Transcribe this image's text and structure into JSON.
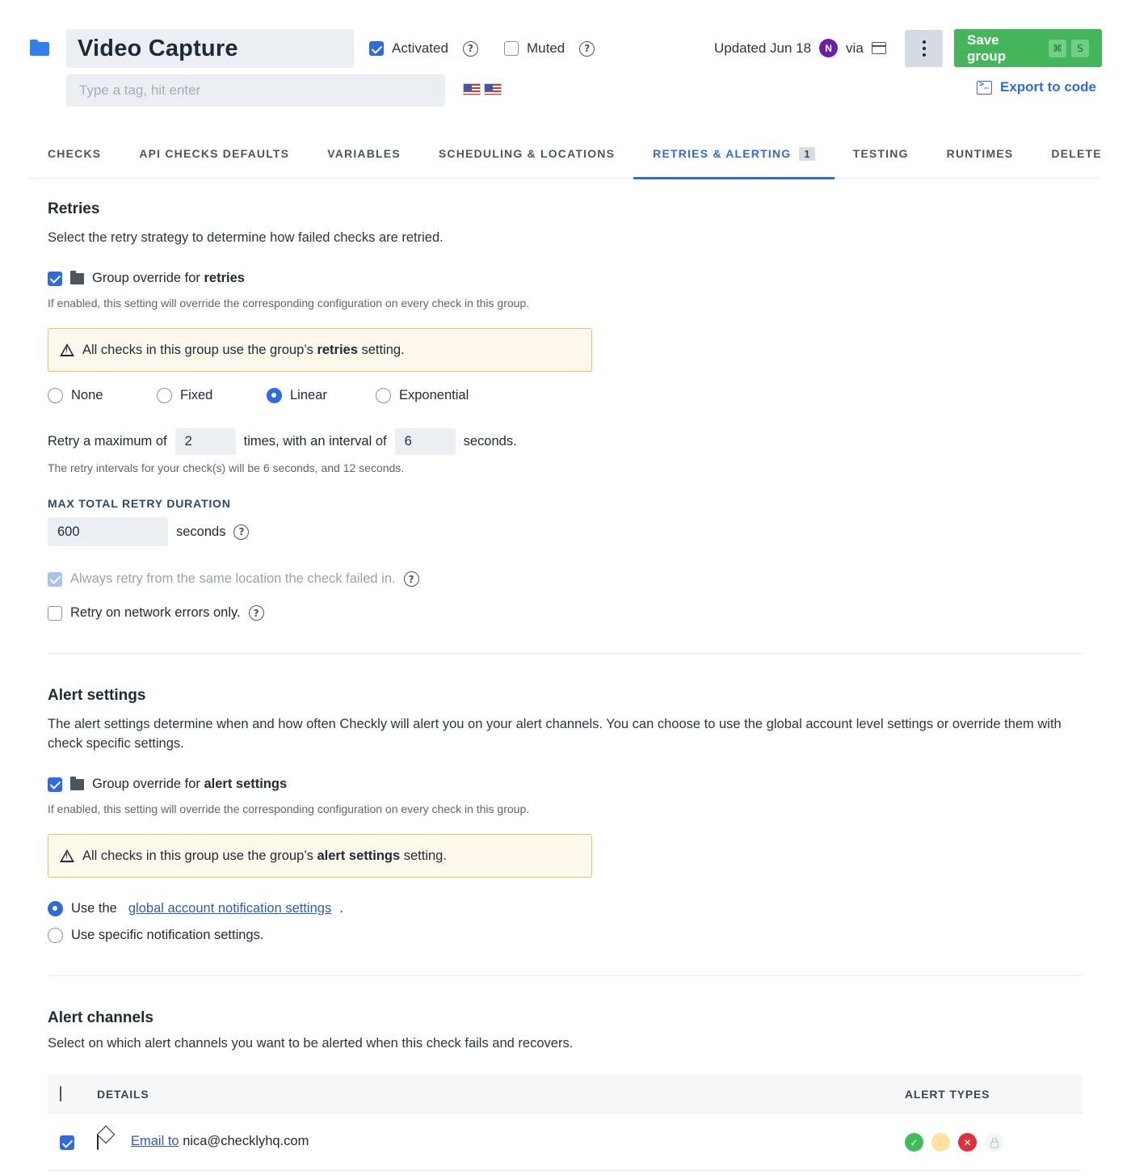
{
  "header": {
    "title": "Video Capture",
    "tag_placeholder": "Type a tag, hit enter",
    "activated_label": "Activated",
    "muted_label": "Muted",
    "updated_label": "Updated Jun 18",
    "avatar_initial": "N",
    "via_label": "via",
    "save_label": "Save group",
    "save_shortcut_keys": [
      "⌘",
      "S"
    ],
    "export_label": "Export to code"
  },
  "tabs": [
    {
      "label": "CHECKS"
    },
    {
      "label": "API CHECKS DEFAULTS"
    },
    {
      "label": "VARIABLES"
    },
    {
      "label": "SCHEDULING & LOCATIONS"
    },
    {
      "label": "RETRIES & ALERTING",
      "count": "1",
      "active": true
    },
    {
      "label": "TESTING"
    },
    {
      "label": "RUNTIMES"
    },
    {
      "label": "DELETE"
    }
  ],
  "retries": {
    "title": "Retries",
    "description": "Select the retry strategy to determine how failed checks are retried.",
    "override_prefix": "Group override for ",
    "override_bold": "retries",
    "override_hint": "If enabled, this setting will override the corresponding configuration on every check in this group.",
    "warning_prefix": "All checks in this group use the group’s ",
    "warning_bold": "retries",
    "warning_suffix": " setting.",
    "strategies": [
      "None",
      "Fixed",
      "Linear",
      "Exponential"
    ],
    "selected_strategy": "Linear",
    "max_prefix": "Retry a maximum of",
    "max_value": "2",
    "interval_mid": "times, with an interval of",
    "interval_value": "6",
    "interval_suffix": "seconds.",
    "interval_hint": "The retry intervals for your check(s) will be 6 seconds, and 12 seconds.",
    "duration_label": "MAX TOTAL RETRY DURATION",
    "duration_value": "600",
    "duration_unit": "seconds",
    "same_location_label": "Always retry from the same location the check failed in.",
    "network_only_label": "Retry on network errors only."
  },
  "alert_settings": {
    "title": "Alert settings",
    "description": "The alert settings determine when and how often Checkly will alert you on your alert channels. You can choose to use the global account level settings or override them with check specific settings.",
    "override_prefix": "Group override for ",
    "override_bold": "alert settings",
    "override_hint": "If enabled, this setting will override the corresponding configuration on every check in this group.",
    "warning_prefix": "All checks in this group use the group’s ",
    "warning_bold": "alert settings",
    "warning_suffix": " setting.",
    "use_global_prefix": "Use the",
    "use_global_link": "global account notification settings",
    "use_global_suffix": ".",
    "use_specific_label": "Use specific notification settings."
  },
  "alert_channels": {
    "title": "Alert channels",
    "description": "Select on which alert channels you want to be alerted when this check fails and recovers.",
    "col_details": "DETAILS",
    "col_alert_types": "ALERT TYPES",
    "rows": [
      {
        "link": "Email to",
        "target": "nica@checklyhq.com"
      }
    ]
  },
  "colors": {
    "accent": "#2f6bdf",
    "save_green": "#45b55c",
    "warning_border": "#e8c068",
    "recovery_green": "#3fbd5a",
    "degraded_yellow": "#fbe3a2",
    "failure_red": "#e0303a"
  }
}
